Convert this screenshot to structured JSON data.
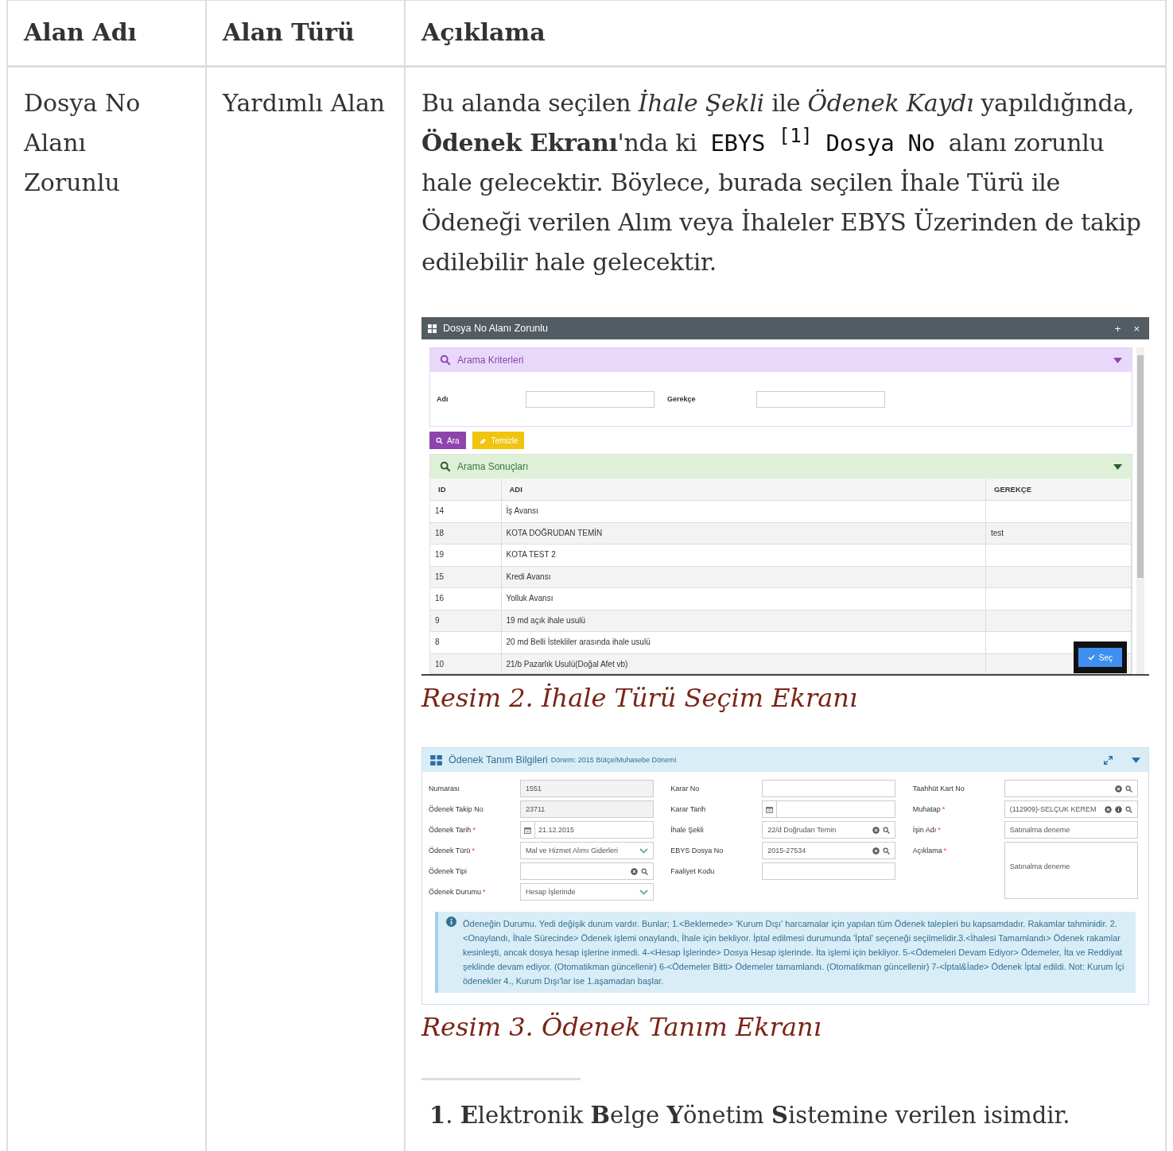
{
  "table": {
    "columns": [
      "Alan Adı",
      "Alan Türü",
      "Açıklama"
    ],
    "rows": [
      {
        "field_name": "Dosya No Alanı Zorunlu",
        "field_type": "Yardımlı Alan",
        "description": {
          "paragraph": [
            {
              "kind": "text",
              "text": "Bu alanda seçilen *İhale Şekli* ile *Ödenek Kaydı* yapıldığında, **Ödenek Ekranı**'nda ki"
            },
            {
              "kind": "code",
              "text": "EBYS"
            },
            {
              "kind": "footnote_ref",
              "text": "[1]"
            },
            {
              "kind": "code",
              "text": "Dosya No"
            },
            {
              "kind": "text",
              "text": "alanı zorunlu hale gelecektir. Böylece, burada seçilen İhale Türü ile Ödeneği verilen Alım veya İhaleler EBYS Üzerinden de takip edilebilir hale gelecektir."
            }
          ],
          "figure_1": {
            "window": {
              "title": "Dosya No Alanı Zorunlu",
              "buttons": [
                "+",
                "×"
              ]
            },
            "search_panel": {
              "title": "Arama Kriterleri",
              "fields": [
                {
                  "label": "Adı"
                },
                {
                  "label": "Gerekçe"
                }
              ]
            },
            "buttons": [
              {
                "kind": "search",
                "label": "Ara"
              },
              {
                "kind": "clear",
                "label": "Temizle"
              }
            ],
            "results_panel": {
              "title": "Arama Sonuçları",
              "columns": [
                "ID",
                "ADI",
                "GEREKÇE"
              ],
              "rows": [
                [
                  "14",
                  "İş Avansı",
                  ""
                ],
                [
                  "18",
                  "KOTA DOĞRUDAN TEMİN",
                  "test"
                ],
                [
                  "19",
                  "KOTA TEST 2",
                  ""
                ],
                [
                  "15",
                  "Kredi Avansı",
                  ""
                ],
                [
                  "16",
                  "Yolluk Avansı",
                  ""
                ],
                [
                  "9",
                  "19 md açık ihale usulü",
                  ""
                ],
                [
                  "8",
                  "20 md Belli İstekliler arasında ihale usulü",
                  ""
                ],
                [
                  "10",
                  "21/b Pazarlık Usulü(Doğal Afet vb)",
                  ""
                ]
              ]
            },
            "select_button": "Seç",
            "caption": "Resim 2. İhale Türü Seçim Ekranı"
          },
          "figure_2": {
            "panel": {
              "title": "Ödenek Tanım Bilgileri",
              "subtitle": "Dönem: 2015 Bütçe/Muhasebe Dönemi"
            },
            "columns": [
              [
                {
                  "label": "Numarası",
                  "kind": "readonly",
                  "value": "1551"
                },
                {
                  "label": "Ödenek Takip No",
                  "kind": "readonly",
                  "value": "23711"
                },
                {
                  "label": "Ödenek Tarih",
                  "required_mark": "*",
                  "kind": "date",
                  "value": "21.12.2015"
                },
                {
                  "label": "Ödenek Türü",
                  "required_mark": "*",
                  "kind": "select",
                  "value": "Mal ve Hizmet Alımı Giderleri"
                },
                {
                  "label": "Ödenek Tipi",
                  "kind": "lookup"
                },
                {
                  "label": "Ödenek Durumu",
                  "required_mark": "*",
                  "kind": "select",
                  "value": "Hesap İşlerinde"
                }
              ],
              [
                {
                  "label": "Karar No",
                  "kind": "text"
                },
                {
                  "label": "Karar Tarih",
                  "kind": "date"
                },
                {
                  "label": "İhale Şekli",
                  "kind": "lookup",
                  "value": "22/d Doğrudan Temin"
                },
                {
                  "label": "EBYS Dosya No",
                  "kind": "lookup",
                  "value": "2015-27534"
                },
                {
                  "label": "Faaliyet Kodu",
                  "kind": "text"
                }
              ],
              [
                {
                  "label": "Taahhüt Kart No",
                  "kind": "lookup"
                },
                {
                  "label": "Muhatap",
                  "required_mark": "*",
                  "kind": "lookup_info",
                  "value": "(112909)-SELÇUK KEREM"
                },
                {
                  "label": "İşin Adı",
                  "required_mark": "*",
                  "kind": "text",
                  "value": "Satınalma deneme"
                },
                {
                  "label": "Açıklama",
                  "required_mark": "*",
                  "kind": "textarea",
                  "value": "Satınalma deneme"
                }
              ]
            ],
            "info": "Ödeneğin Durumu. Yedi değişik durum vardır. Bunlar; 1.<Beklemede> 'Kurum Dışı' harcamalar için yapılan tüm Ödenek talepleri bu kapsamdadır. Rakamlar tahminidir. 2.<Onaylandı, İhale Sürecinde> Ödenek işlemi onaylandı, İhale için bekliyor. İptal edilmesi durumunda 'İptal' seçeneği seçilmelidir.3.<İhalesi Tamamlandı> Ödenek rakamlar kesinleşti, ancak dosya hesap işlerine inmedi. 4-<Hesap İşlerinde> Dosya Hesap işlerinde. İta işlemi için bekliyor. 5-<Ödemeleri Devam Ediyor> Ödemeler, İta ve Reddiyat şeklinde devam ediyor. (Otomatikman güncellenir) 6-<Ödemeler Bitti> Ödemeler tamamlandı. (Otomatikman güncellenir) 7-<İptal&İade> Ödenek İptal edildi. Not: Kurum İçi ödenekler 4., Kurum Dışı'lar ise 1.aşamadan başlar.",
            "caption": "Resim 3. Ödenek Tanım Ekranı"
          },
          "footnotes": [
            "**1**. **E**lektronik **B**elge **Y**önetim **S**istemine verilen isimdir."
          ]
        }
      }
    ]
  }
}
